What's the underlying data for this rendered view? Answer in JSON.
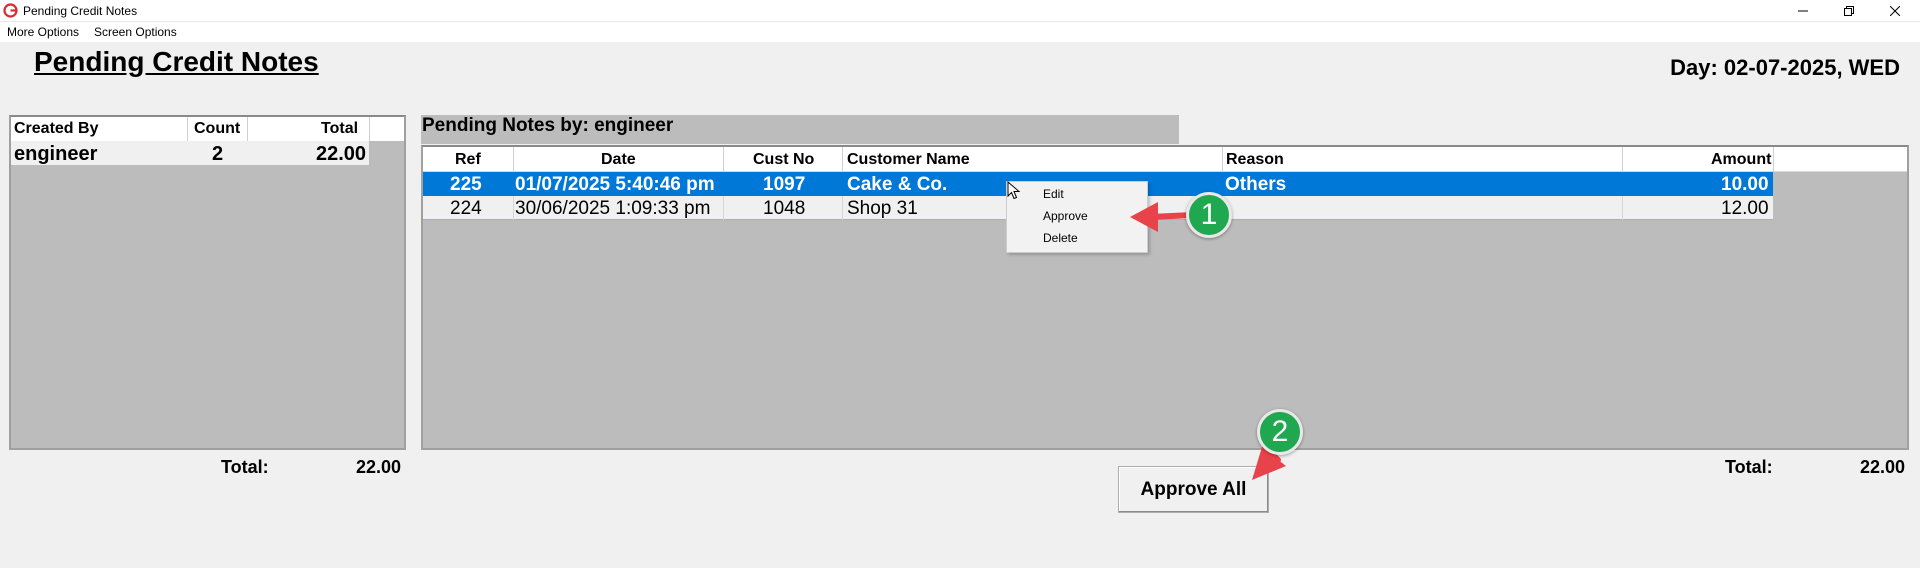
{
  "window": {
    "title": "Pending Credit Notes",
    "controls": {
      "minimize": "minimize-icon",
      "maximize": "restore-icon",
      "close": "close-icon"
    }
  },
  "menu": {
    "more_options": "More Options",
    "screen_options": "Screen Options"
  },
  "page": {
    "title": "Pending Credit Notes",
    "day": "Day: 02-07-2025, WED"
  },
  "summary": {
    "headers": {
      "created_by": "Created By",
      "count": "Count",
      "total": "Total"
    },
    "rows": [
      {
        "created_by": "engineer",
        "count": "2",
        "total": "22.00"
      }
    ],
    "total_label": "Total:",
    "total_value": "22.00"
  },
  "notes": {
    "label": "Pending Notes by: engineer",
    "headers": {
      "ref": "Ref",
      "date": "Date",
      "cust_no": "Cust No",
      "customer_name": "Customer Name",
      "reason": "Reason",
      "amount": "Amount"
    },
    "rows": [
      {
        "ref": "225",
        "date": "01/07/2025 5:40:46 pm",
        "cust_no": "1097",
        "customer_name": "Cake & Co.",
        "reason": "Others",
        "amount": "10.00",
        "selected": true
      },
      {
        "ref": "224",
        "date": "30/06/2025 1:09:33 pm",
        "cust_no": "1048",
        "customer_name": "Shop 31",
        "reason": "",
        "amount": "12.00",
        "selected": false
      }
    ],
    "total_label": "Total:",
    "total_value": "22.00"
  },
  "context_menu": {
    "items": [
      "Edit",
      "Approve",
      "Delete"
    ]
  },
  "approve_all_label": "Approve All",
  "annotations": {
    "badge_1": "1",
    "badge_2": "2"
  },
  "colors": {
    "selection": "#0078d7",
    "grid_bg": "#bcbcbc",
    "badge": "#1fa84f",
    "arrow": "#e8434a"
  }
}
